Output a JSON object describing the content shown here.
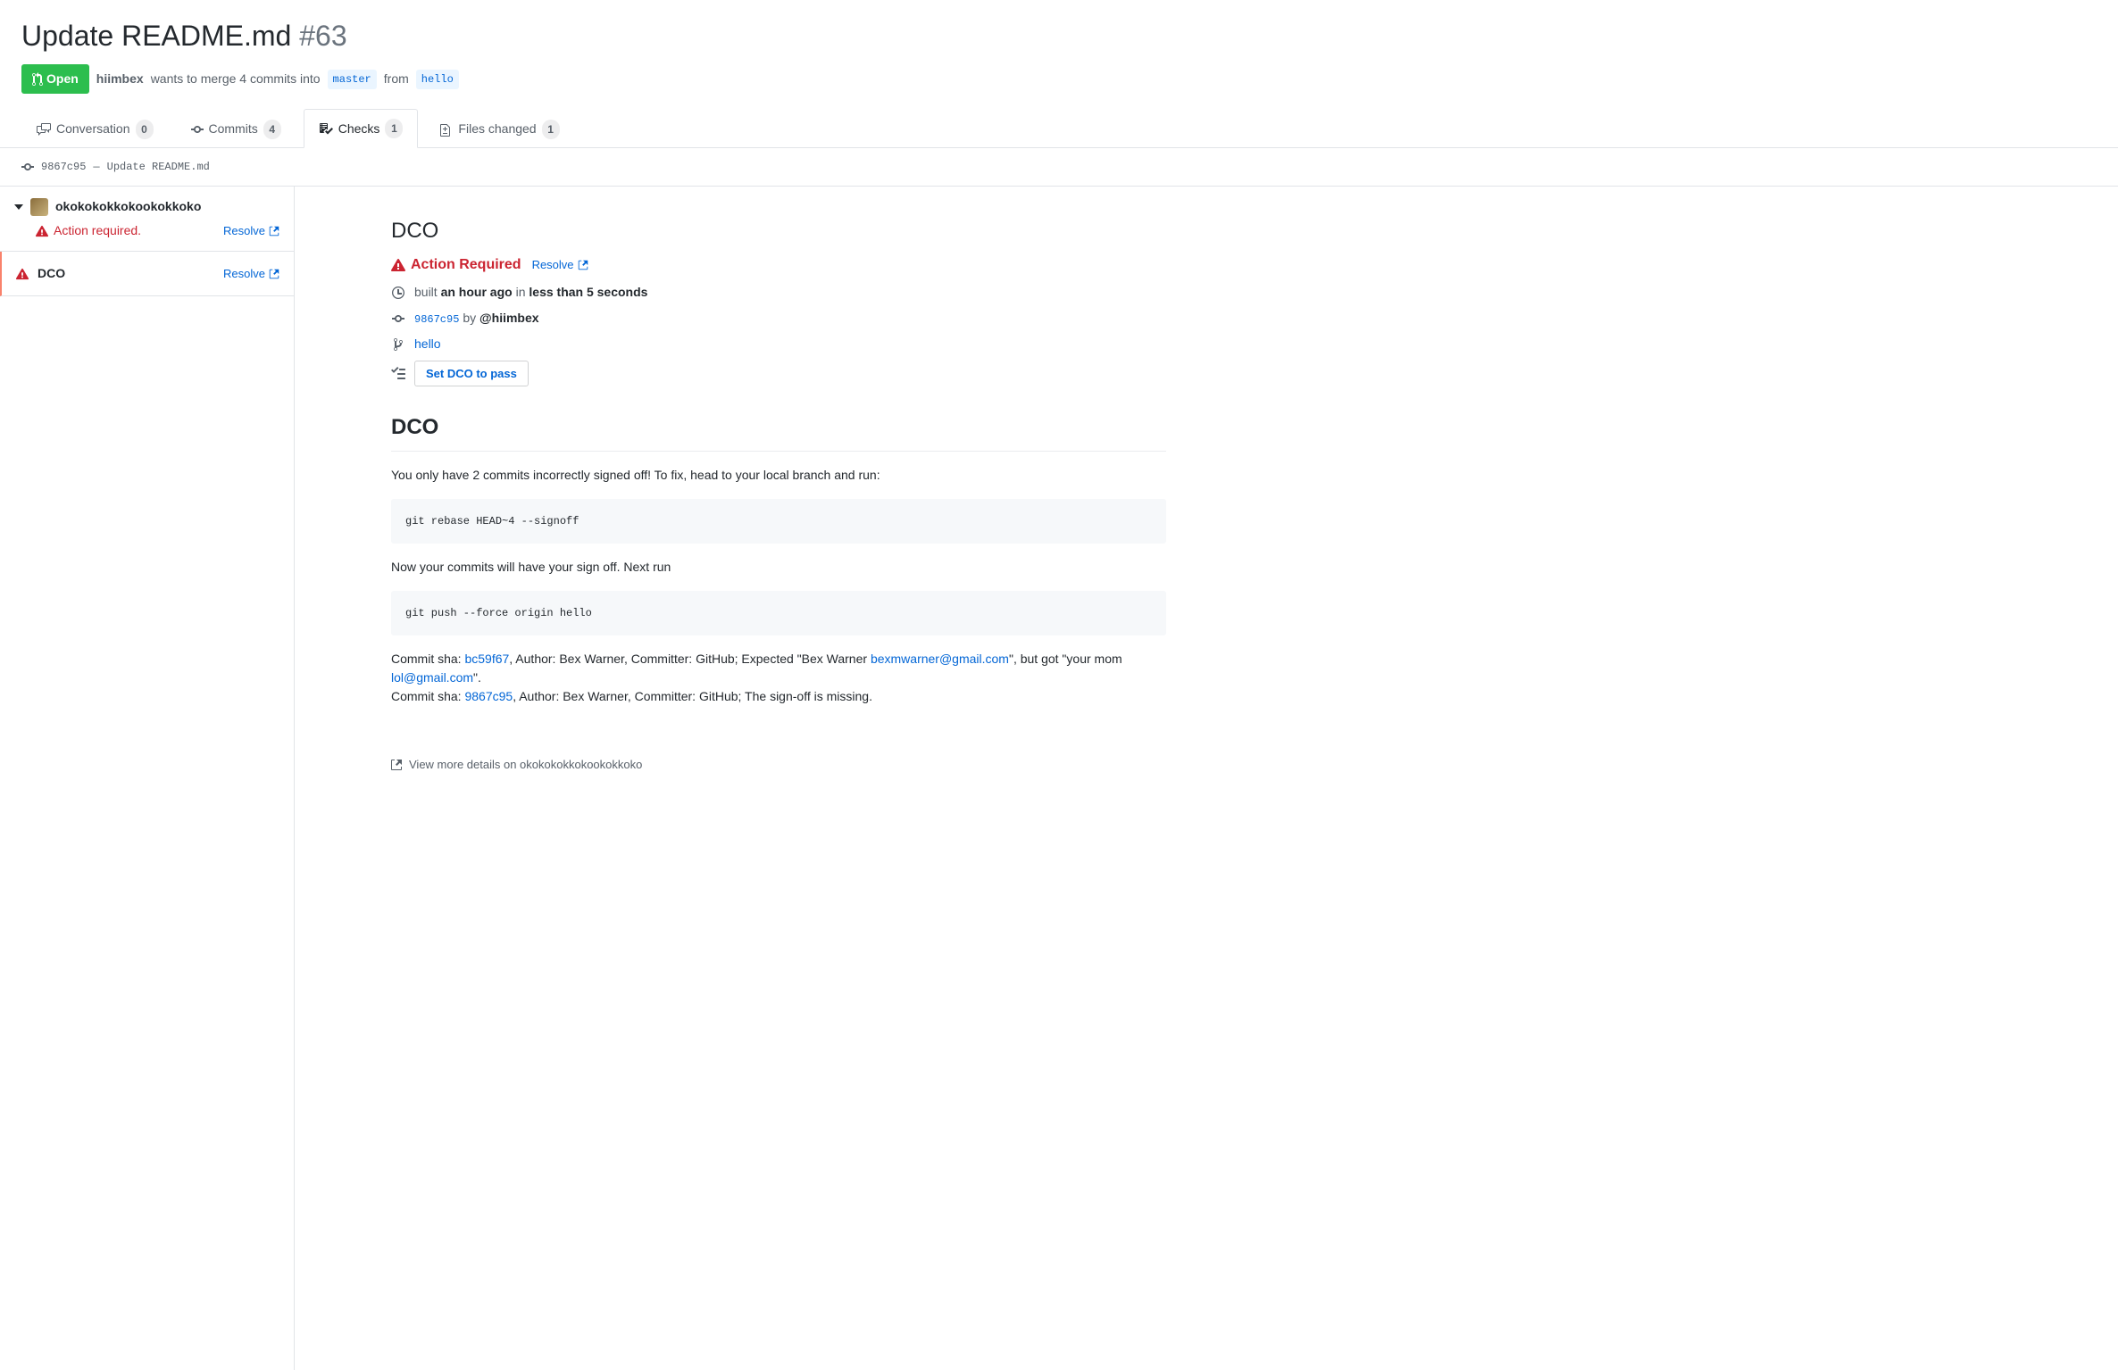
{
  "header": {
    "title": "Update README.md",
    "pr_number": "#63",
    "state": "Open",
    "author": "hiimbex",
    "meta_line_1": "wants to merge 4 commits into",
    "base_branch": "master",
    "meta_from": "from",
    "head_branch": "hello"
  },
  "tabs": {
    "conversation": {
      "label": "Conversation",
      "count": "0"
    },
    "commits": {
      "label": "Commits",
      "count": "4"
    },
    "checks": {
      "label": "Checks",
      "count": "1"
    },
    "files": {
      "label": "Files changed",
      "count": "1"
    }
  },
  "commit_line": {
    "sha": "9867c95",
    "dash": "—",
    "message": "Update README.md"
  },
  "sidebar": {
    "app_name": "okokokokkokookokkoko",
    "status_text": "Action required.",
    "resolve_label": "Resolve",
    "check_name": "DCO"
  },
  "main": {
    "title": "DCO",
    "status": "Action Required",
    "resolve": "Resolve",
    "built_prefix": "built",
    "built_time": "an hour ago",
    "built_in": "in",
    "duration": "less than 5 seconds",
    "commit_sha": "9867c95",
    "by": "by",
    "author": "@hiimbex",
    "branch": "hello",
    "set_pass_btn": "Set DCO to pass",
    "section_heading": "DCO",
    "body1": "You only have 2 commits incorrectly signed off! To fix, head to your local branch and run:",
    "code1": "git rebase HEAD~4 --signoff",
    "body2": "Now your commits will have your sign off. Next run",
    "code2": "git push --force origin hello",
    "commit_details": {
      "line1_prefix": "Commit sha: ",
      "sha1": "bc59f67",
      "line1_mid": ", Author: Bex Warner, Committer: GitHub; Expected \"Bex Warner ",
      "email1": "bexmwarner@gmail.com",
      "line1_mid2": "\", but got \"your mom ",
      "email2": "lol@gmail.com",
      "line1_end": "\".",
      "line2_prefix": "Commit sha: ",
      "sha2": "9867c95",
      "line2_end": ", Author: Bex Warner, Committer: GitHub; The sign-off is missing."
    },
    "footer": "View more details on okokokokkokookokkoko"
  }
}
